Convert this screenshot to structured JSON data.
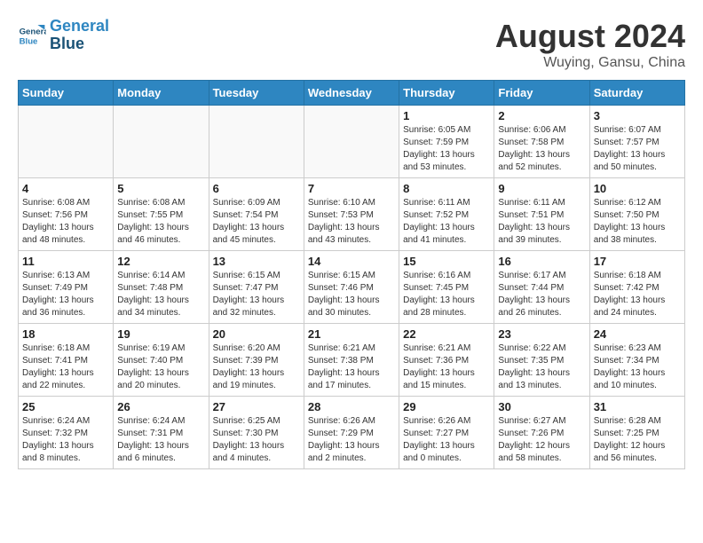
{
  "logo": {
    "line1": "General",
    "line2": "Blue"
  },
  "title": "August 2024",
  "location": "Wuying, Gansu, China",
  "weekdays": [
    "Sunday",
    "Monday",
    "Tuesday",
    "Wednesday",
    "Thursday",
    "Friday",
    "Saturday"
  ],
  "weeks": [
    [
      {
        "day": "",
        "empty": true
      },
      {
        "day": "",
        "empty": true
      },
      {
        "day": "",
        "empty": true
      },
      {
        "day": "",
        "empty": true
      },
      {
        "day": "1",
        "sunrise": "6:05 AM",
        "sunset": "7:59 PM",
        "daylight": "13 hours and 53 minutes."
      },
      {
        "day": "2",
        "sunrise": "6:06 AM",
        "sunset": "7:58 PM",
        "daylight": "13 hours and 52 minutes."
      },
      {
        "day": "3",
        "sunrise": "6:07 AM",
        "sunset": "7:57 PM",
        "daylight": "13 hours and 50 minutes."
      }
    ],
    [
      {
        "day": "4",
        "sunrise": "6:08 AM",
        "sunset": "7:56 PM",
        "daylight": "13 hours and 48 minutes."
      },
      {
        "day": "5",
        "sunrise": "6:08 AM",
        "sunset": "7:55 PM",
        "daylight": "13 hours and 46 minutes."
      },
      {
        "day": "6",
        "sunrise": "6:09 AM",
        "sunset": "7:54 PM",
        "daylight": "13 hours and 45 minutes."
      },
      {
        "day": "7",
        "sunrise": "6:10 AM",
        "sunset": "7:53 PM",
        "daylight": "13 hours and 43 minutes."
      },
      {
        "day": "8",
        "sunrise": "6:11 AM",
        "sunset": "7:52 PM",
        "daylight": "13 hours and 41 minutes."
      },
      {
        "day": "9",
        "sunrise": "6:11 AM",
        "sunset": "7:51 PM",
        "daylight": "13 hours and 39 minutes."
      },
      {
        "day": "10",
        "sunrise": "6:12 AM",
        "sunset": "7:50 PM",
        "daylight": "13 hours and 38 minutes."
      }
    ],
    [
      {
        "day": "11",
        "sunrise": "6:13 AM",
        "sunset": "7:49 PM",
        "daylight": "13 hours and 36 minutes."
      },
      {
        "day": "12",
        "sunrise": "6:14 AM",
        "sunset": "7:48 PM",
        "daylight": "13 hours and 34 minutes."
      },
      {
        "day": "13",
        "sunrise": "6:15 AM",
        "sunset": "7:47 PM",
        "daylight": "13 hours and 32 minutes."
      },
      {
        "day": "14",
        "sunrise": "6:15 AM",
        "sunset": "7:46 PM",
        "daylight": "13 hours and 30 minutes."
      },
      {
        "day": "15",
        "sunrise": "6:16 AM",
        "sunset": "7:45 PM",
        "daylight": "13 hours and 28 minutes."
      },
      {
        "day": "16",
        "sunrise": "6:17 AM",
        "sunset": "7:44 PM",
        "daylight": "13 hours and 26 minutes."
      },
      {
        "day": "17",
        "sunrise": "6:18 AM",
        "sunset": "7:42 PM",
        "daylight": "13 hours and 24 minutes."
      }
    ],
    [
      {
        "day": "18",
        "sunrise": "6:18 AM",
        "sunset": "7:41 PM",
        "daylight": "13 hours and 22 minutes."
      },
      {
        "day": "19",
        "sunrise": "6:19 AM",
        "sunset": "7:40 PM",
        "daylight": "13 hours and 20 minutes."
      },
      {
        "day": "20",
        "sunrise": "6:20 AM",
        "sunset": "7:39 PM",
        "daylight": "13 hours and 19 minutes."
      },
      {
        "day": "21",
        "sunrise": "6:21 AM",
        "sunset": "7:38 PM",
        "daylight": "13 hours and 17 minutes."
      },
      {
        "day": "22",
        "sunrise": "6:21 AM",
        "sunset": "7:36 PM",
        "daylight": "13 hours and 15 minutes."
      },
      {
        "day": "23",
        "sunrise": "6:22 AM",
        "sunset": "7:35 PM",
        "daylight": "13 hours and 13 minutes."
      },
      {
        "day": "24",
        "sunrise": "6:23 AM",
        "sunset": "7:34 PM",
        "daylight": "13 hours and 10 minutes."
      }
    ],
    [
      {
        "day": "25",
        "sunrise": "6:24 AM",
        "sunset": "7:32 PM",
        "daylight": "13 hours and 8 minutes."
      },
      {
        "day": "26",
        "sunrise": "6:24 AM",
        "sunset": "7:31 PM",
        "daylight": "13 hours and 6 minutes."
      },
      {
        "day": "27",
        "sunrise": "6:25 AM",
        "sunset": "7:30 PM",
        "daylight": "13 hours and 4 minutes."
      },
      {
        "day": "28",
        "sunrise": "6:26 AM",
        "sunset": "7:29 PM",
        "daylight": "13 hours and 2 minutes."
      },
      {
        "day": "29",
        "sunrise": "6:26 AM",
        "sunset": "7:27 PM",
        "daylight": "13 hours and 0 minutes."
      },
      {
        "day": "30",
        "sunrise": "6:27 AM",
        "sunset": "7:26 PM",
        "daylight": "12 hours and 58 minutes."
      },
      {
        "day": "31",
        "sunrise": "6:28 AM",
        "sunset": "7:25 PM",
        "daylight": "12 hours and 56 minutes."
      }
    ]
  ]
}
